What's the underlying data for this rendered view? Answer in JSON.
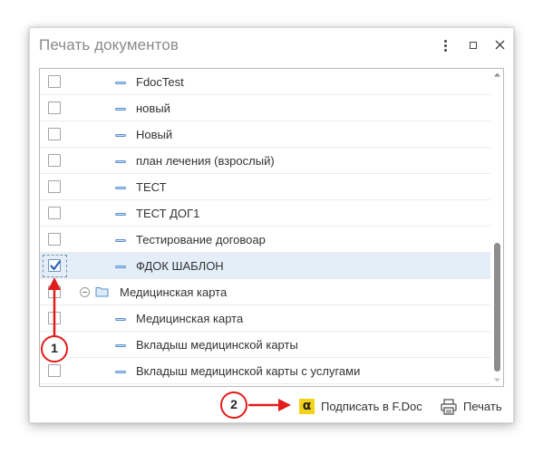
{
  "window": {
    "title": "Печать документов"
  },
  "list": {
    "rows": [
      {
        "type": "doc",
        "label": "FdocTest",
        "checked": false
      },
      {
        "type": "doc",
        "label": "новый",
        "checked": false
      },
      {
        "type": "doc",
        "label": "Новый",
        "checked": false
      },
      {
        "type": "doc",
        "label": "план лечения (взрослый)",
        "checked": false
      },
      {
        "type": "doc",
        "label": "ТЕСТ",
        "checked": false
      },
      {
        "type": "doc",
        "label": "ТЕСТ ДОГ1",
        "checked": false
      },
      {
        "type": "doc",
        "label": "Тестирование договоар",
        "checked": false
      },
      {
        "type": "doc",
        "label": "ФДОК ШАБЛОН",
        "checked": true
      },
      {
        "type": "group",
        "label": "Медицинская карта",
        "checked": false
      },
      {
        "type": "doc",
        "label": "Медицинская карта",
        "checked": false
      },
      {
        "type": "doc",
        "label": "Вкладыш медицинской карты",
        "checked": false
      },
      {
        "type": "doc",
        "label": "Вкладыш медицинской карты с услугами",
        "checked": false
      }
    ]
  },
  "footer": {
    "sign_label": "Подписать в F.Doc",
    "sign_icon_glyph": "α",
    "print_label": "Печать"
  },
  "annotations": [
    {
      "number": "1"
    },
    {
      "number": "2"
    }
  ],
  "colors": {
    "accent_yellow": "#f3d21a",
    "annotation_red": "#e11c1c",
    "selected_row": "#e4eef9"
  }
}
